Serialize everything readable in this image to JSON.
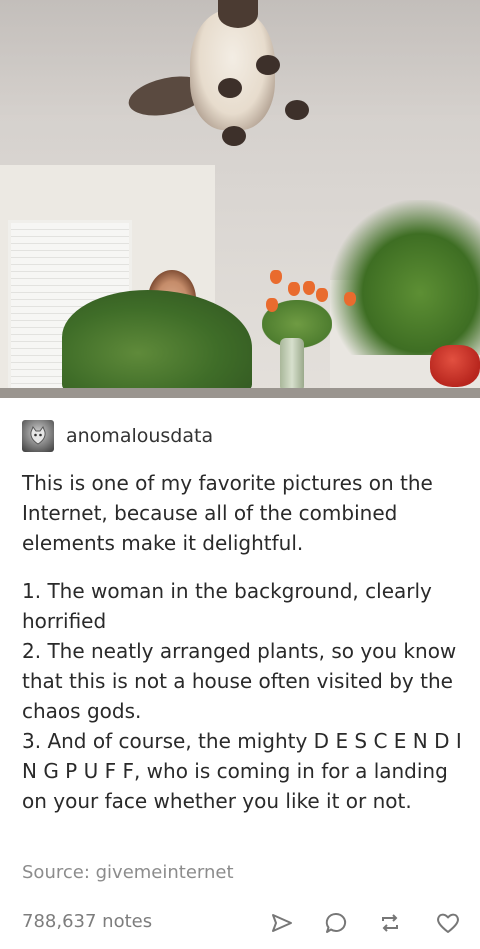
{
  "post": {
    "username": "anomalousdata",
    "paragraphs": [
      "This is one of my favorite pictures on the Internet, because all of the combined elements make it delightful.",
      "1. The woman in the background, clearly horrified\n2. The neatly arranged plants, so you know that this is not a house often visited by the chaos gods.\n3. And of course, the mighty D E S C E N D I N G  P U F F, who is coming in for a landing on your face whether you like it or not."
    ],
    "source": "Source: givemeinternet",
    "notes": "788,637 notes"
  },
  "icons": {
    "avatar": "cat-avatar-icon",
    "share": "send-icon",
    "reply": "comment-icon",
    "reblog": "reblog-icon",
    "like": "heart-icon"
  },
  "colors": {
    "icon": "#777777",
    "text": "#2a2a2a",
    "muted": "#8c8c8c"
  }
}
